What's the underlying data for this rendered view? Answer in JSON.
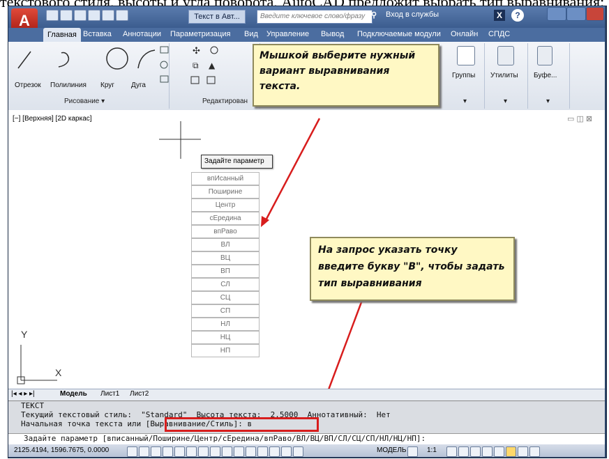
{
  "caption": "текстового стиля, высоты и угла поворота, АutoCAD предложит выбрать тип выравнивания:",
  "titlebar": {
    "logo_letter": "A",
    "title": "Текст в Авт...",
    "search_placeholder": "Введите ключевое слово/фразу",
    "signin": "Вход в службы",
    "help": "?",
    "x_button": "X"
  },
  "tabs": [
    "Главная",
    "Вставка",
    "Аннотации",
    "Параметризация",
    "Вид",
    "Управление",
    "Вывод",
    "Подключаемые модули",
    "Онлайн",
    "СПДС"
  ],
  "ribbon": {
    "tools": [
      "Отрезок",
      "Полилиния",
      "Круг",
      "Дуга"
    ],
    "panel_draw": "Рисование",
    "panel_modify": "Редактирован",
    "right_tools": [
      "Группы",
      "Утилиты",
      "Буфе..."
    ]
  },
  "viewport": {
    "label": "[−] [Верхняя] [2D каркас]",
    "controls": "▭ ◫ ⊠",
    "ucs_y": "Y",
    "ucs_x": "X"
  },
  "options_menu": {
    "title": "Задайте параметр",
    "items": [
      "впИсанный",
      "Поширине",
      "Центр",
      "сЕредина",
      "впРаво",
      "ВЛ",
      "ВЦ",
      "ВП",
      "СЛ",
      "СЦ",
      "СП",
      "НЛ",
      "НЦ",
      "НП"
    ]
  },
  "callouts": {
    "top": "Мышкой выберите нужный вариант выравнивания текста.",
    "bottom": "На запрос указать точку введите букву \"В\", чтобы задать тип выравнивания"
  },
  "layout_tabs": [
    "Модель",
    "Лист1",
    "Лист2"
  ],
  "command": {
    "lines": [
      "ТЕКСТ",
      "Текущий текстовый стиль:  \"Standard\"  Высота текста:  2.5000  Аннотативный:  Нет",
      "Начальная точка текста или [Выравнивание/Стиль]: в"
    ],
    "input": "Задайте параметр [вписанный/Поширине/Центр/сЕредина/впРаво/ВЛ/ВЦ/ВП/СЛ/СЦ/СП/НЛ/НЦ/НП]:"
  },
  "status": {
    "coords": "2125.4194, 1596.7675, 0.0000",
    "model": "МОДЕЛЬ",
    "scale": "1:1"
  },
  "colors": {
    "callout_bg": "#fff8c4",
    "arrow": "#d81d1d",
    "titlebar": "#3c5d8f"
  }
}
